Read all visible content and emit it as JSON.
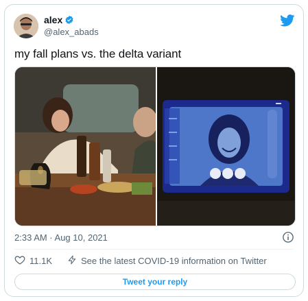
{
  "author": {
    "display_name": "alex",
    "handle": "@alex_abads",
    "verified": true
  },
  "tweet": {
    "text": "my fall plans vs. the delta variant",
    "timestamp": "2:33 AM · Aug 10, 2021"
  },
  "engagement": {
    "likes": "11.1K",
    "covid_info": "See the latest COVID-19 information on Twitter"
  },
  "reply": {
    "label": "Tweet your reply"
  },
  "colors": {
    "brand_blue": "#1d9bf0",
    "muted_text": "#536471",
    "border": "#cfd9de"
  },
  "icons": [
    "verified-badge-icon",
    "twitter-bird-icon",
    "info-icon",
    "heart-icon",
    "lightning-icon"
  ]
}
